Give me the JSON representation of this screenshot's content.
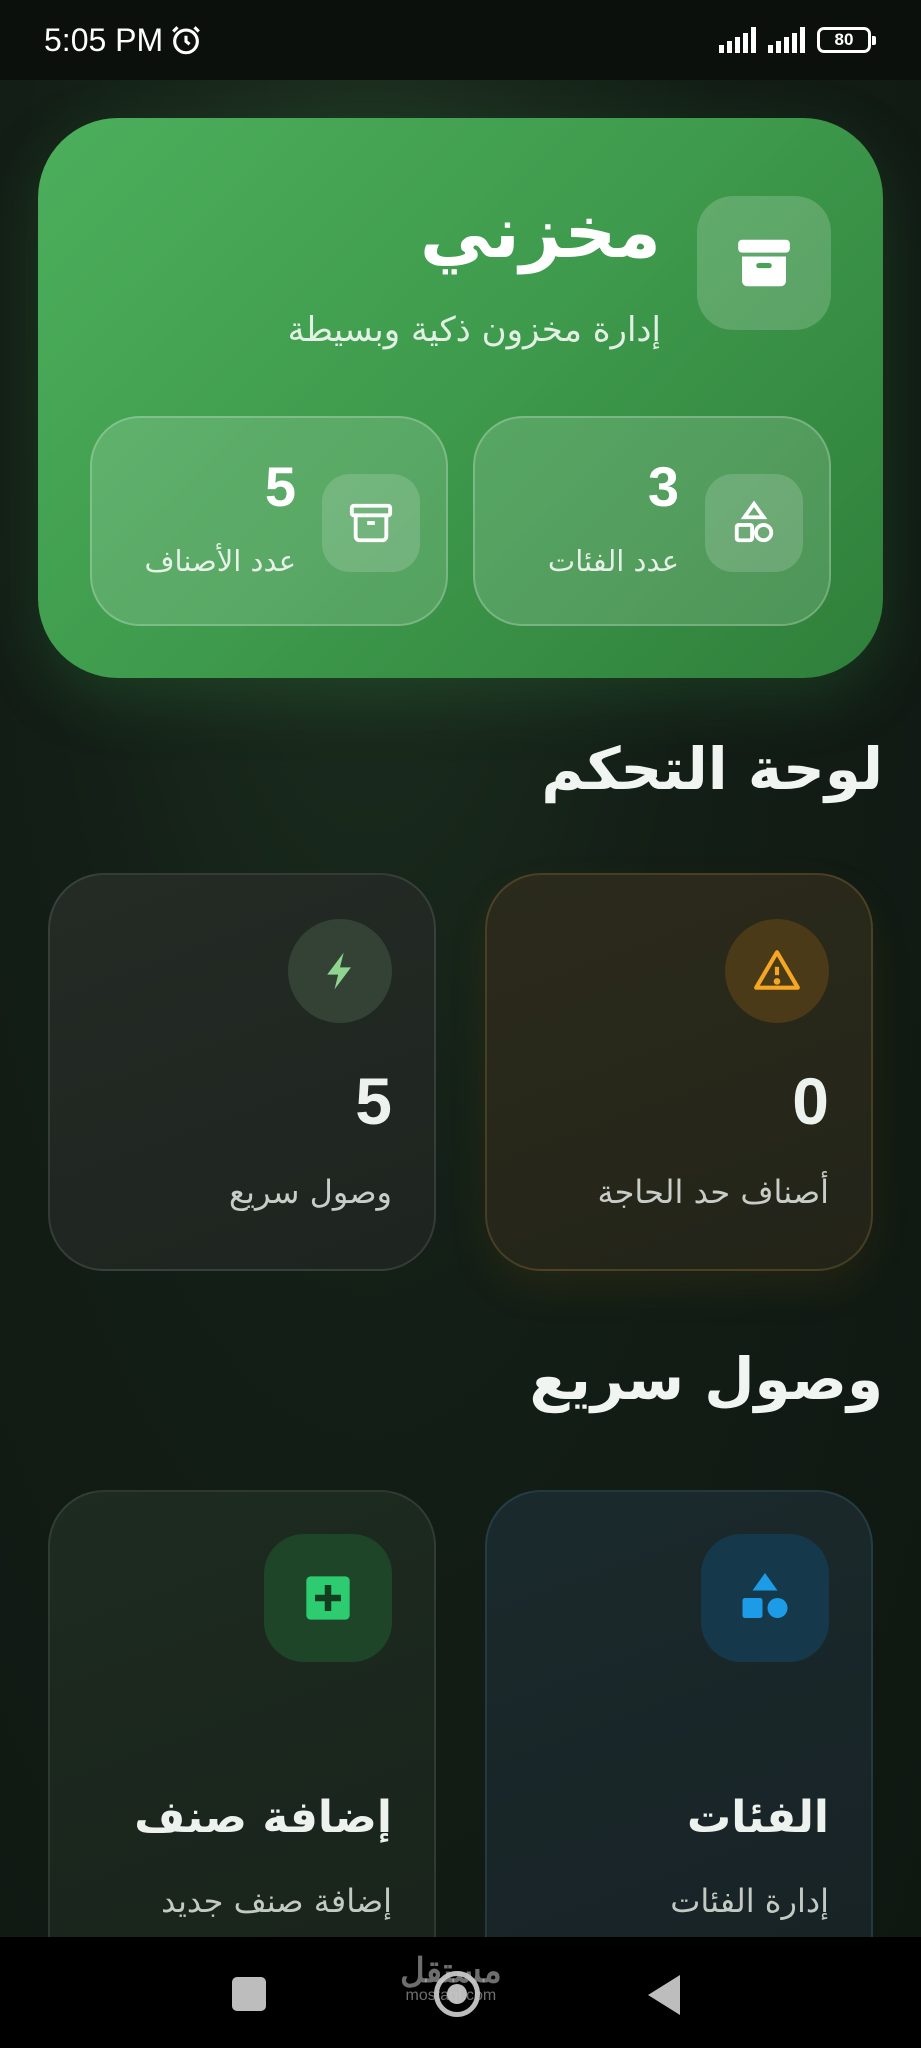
{
  "status_bar": {
    "time": "5:05 PM",
    "battery": "80"
  },
  "hero": {
    "title": "مخزني",
    "subtitle": "إدارة مخزون ذكية وبسيطة",
    "stats": [
      {
        "value": "3",
        "label": "عدد الفئات",
        "icon": "shapes-icon"
      },
      {
        "value": "5",
        "label": "عدد الأصناف",
        "icon": "archive-icon"
      }
    ]
  },
  "dashboard": {
    "title": "لوحة التحكم",
    "cards": [
      {
        "value": "0",
        "label": "أصناف حد الحاجة",
        "icon": "warning-icon",
        "accent": "#f5a623"
      },
      {
        "value": "5",
        "label": "وصول سريع",
        "icon": "bolt-icon",
        "accent": "#8fd48f"
      }
    ]
  },
  "quick_access": {
    "title": "وصول سريع",
    "cards": [
      {
        "title": "الفئات",
        "subtitle": "إدارة الفئات",
        "icon": "shapes-icon",
        "accent": "#2196f3"
      },
      {
        "title": "إضافة صنف",
        "subtitle": "إضافة صنف جديد",
        "icon": "add-box-icon",
        "accent": "#2ecc71"
      }
    ]
  },
  "watermark": {
    "main": "مستقل",
    "sub": "mostaql.com"
  },
  "colors": {
    "hero_green": "#43a552",
    "warning": "#f5a623",
    "categories_blue": "#1e9be6",
    "add_green": "#2ecc71"
  }
}
